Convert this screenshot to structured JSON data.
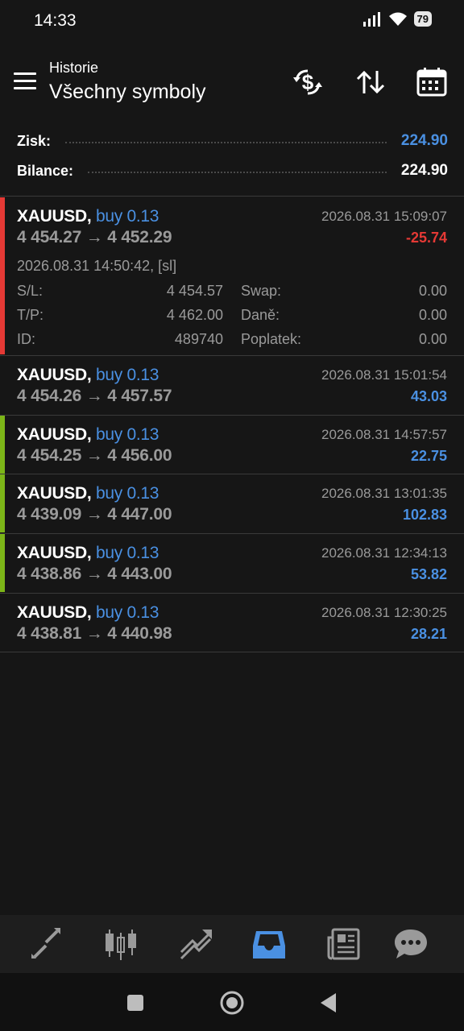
{
  "status": {
    "time": "14:33",
    "battery": "79"
  },
  "header": {
    "subtitle": "Historie",
    "title": "Všechny symboly"
  },
  "summary": {
    "profit_label": "Zisk:",
    "profit_value": "224.90",
    "balance_label": "Bilance:",
    "balance_value": "224.90"
  },
  "expanded": {
    "open_time": "2026.08.31 14:50:42, [sl]",
    "sl_label": "S/L:",
    "sl_value": "4 454.57",
    "tp_label": "T/P:",
    "tp_value": "4 462.00",
    "id_label": "ID:",
    "id_value": "489740",
    "swap_label": "Swap:",
    "swap_value": "0.00",
    "tax_label": "Daně:",
    "tax_value": "0.00",
    "fee_label": "Poplatek:",
    "fee_value": "0.00"
  },
  "trades": [
    {
      "symbol": "XAUUSD,",
      "side": "buy 0.13",
      "prices": "4 454.27 → 4 452.29",
      "time": "2026.08.31 15:09:07",
      "profit": "-25.74"
    },
    {
      "symbol": "XAUUSD,",
      "side": "buy 0.13",
      "prices": "4 454.26 → 4 457.57",
      "time": "2026.08.31 15:01:54",
      "profit": "43.03"
    },
    {
      "symbol": "XAUUSD,",
      "side": "buy 0.13",
      "prices": "4 454.25 → 4 456.00",
      "time": "2026.08.31 14:57:57",
      "profit": "22.75"
    },
    {
      "symbol": "XAUUSD,",
      "side": "buy 0.13",
      "prices": "4 439.09 → 4 447.00",
      "time": "2026.08.31 13:01:35",
      "profit": "102.83"
    },
    {
      "symbol": "XAUUSD,",
      "side": "buy 0.13",
      "prices": "4 438.86 → 4 443.00",
      "time": "2026.08.31 12:34:13",
      "profit": "53.82"
    },
    {
      "symbol": "XAUUSD,",
      "side": "buy 0.13",
      "prices": "4 438.81 → 4 440.98",
      "time": "2026.08.31 12:30:25",
      "profit": "28.21"
    }
  ],
  "colors": {
    "accent": "#4a90e2",
    "loss": "#e53935",
    "win_bar": "#7cb518",
    "loss_bar": "#e53935",
    "background": "#161616",
    "muted": "#9a9a9a"
  },
  "icons": {
    "menu": "menu-icon",
    "currency_swap": "currency-swap-icon",
    "sort": "sort-icon",
    "calendar": "calendar-icon",
    "nav": [
      "quotes-icon",
      "chart-candles-icon",
      "trade-icon",
      "history-inbox-icon",
      "news-icon",
      "chat-icon"
    ],
    "system": [
      "recents-square-icon",
      "home-circle-icon",
      "back-triangle-icon"
    ]
  }
}
